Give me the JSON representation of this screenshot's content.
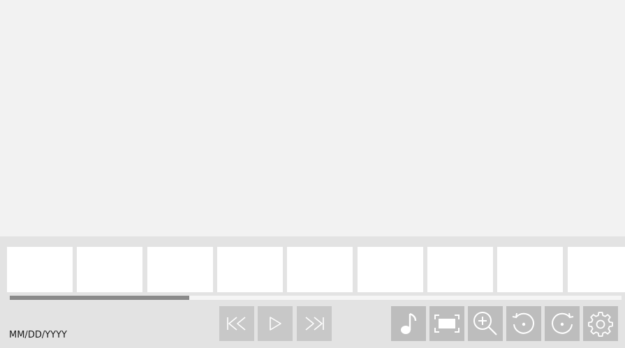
{
  "viewer": {
    "image": "blank"
  },
  "thumbnails": {
    "count": 9
  },
  "progress": {
    "fraction": 0.293
  },
  "date": {
    "placeholder_text": "MM/DD/YYYY"
  },
  "playback": {
    "previous_icon": "skip-back-icon",
    "play_icon": "play-icon",
    "next_icon": "skip-forward-icon",
    "enabled": false
  },
  "tools": {
    "music_icon": "music-note-icon",
    "fit_icon": "fit-to-screen-icon",
    "zoom_icon": "zoom-in-icon",
    "rotate_left_icon": "rotate-left-icon",
    "rotate_right_icon": "rotate-right-icon",
    "settings_icon": "gear-icon"
  },
  "colors": {
    "viewer_bg": "#f2f2f2",
    "panel_bg": "#e3e3e3",
    "thumb_bg": "#ffffff",
    "progress_fill": "#8a8a8a",
    "button_bg": "#bdbdbd",
    "icon_color": "#ffffff"
  }
}
